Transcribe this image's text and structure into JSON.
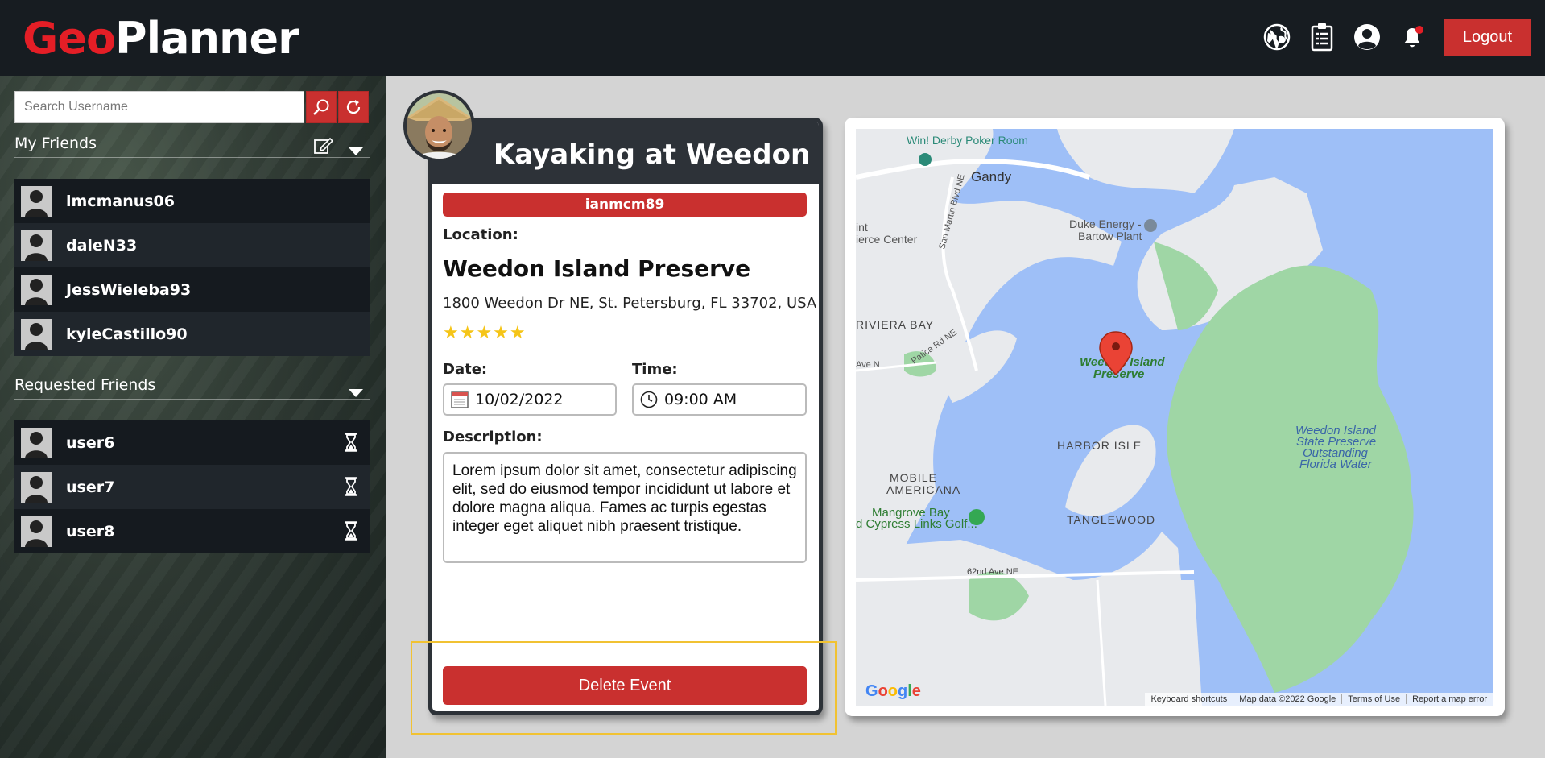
{
  "app": {
    "logo_part1": "Geo",
    "logo_part2": "Planner",
    "logout_label": "Logout",
    "header_icons": [
      "globe-icon",
      "clipboard-icon",
      "user-circle-icon",
      "bell-icon"
    ],
    "accent_color": "#c9302f",
    "logo_red": "#e41e26"
  },
  "sidebar": {
    "search_placeholder": "Search Username",
    "my_friends_title": "My Friends",
    "friends": [
      {
        "name": "lmcmanus06"
      },
      {
        "name": "daleN33"
      },
      {
        "name": "JessWieleba93"
      },
      {
        "name": "kyleCastillo90"
      }
    ],
    "requested_title": "Requested Friends",
    "requested": [
      {
        "name": "user6"
      },
      {
        "name": "user7"
      },
      {
        "name": "user8"
      }
    ]
  },
  "event": {
    "title": "Kayaking at Weedon",
    "owner": "ianmcm89",
    "location_label": "Location:",
    "place_name": "Weedon Island Preserve",
    "address": "1800 Weedon Dr NE, St. Petersburg, FL 33702, USA",
    "rating": "★★★★★",
    "date_label": "Date:",
    "date_value": "10/02/2022",
    "time_label": "Time:",
    "time_value": "09:00 AM",
    "description_label": "Description:",
    "description": "Lorem ipsum dolor sit amet, consectetur adipiscing elit, sed do eiusmod tempor incididunt ut labore et dolore magna aliqua. Fames ac turpis egestas integer eget aliquet nibh praesent tristique.",
    "delete_label": "Delete Event"
  },
  "map": {
    "labels": {
      "poker": "Win! Derby Poker Room",
      "gandy": "Gandy",
      "duke1": "Duke Energy -",
      "duke2": "Bartow Plant",
      "commerce1": "int",
      "commerce2": "ierce Center",
      "riviera": "RIVIERA BAY",
      "san_martin": "San Martin Blvd NE",
      "patica": "Patica Rd NE",
      "ave_n": "Ave N",
      "weedon1": "Weedon Island",
      "weedon2": "Preserve",
      "harbor": "HARBOR ISLE",
      "state1": "Weedon Island",
      "state2": "State Preserve",
      "state3": "Outstanding",
      "state4": "Florida Water",
      "mobile1": "MOBILE",
      "mobile2": "AMERICANA",
      "mangrove1": "Mangrove Bay",
      "mangrove2": "d Cypress Links Golf...",
      "tanglewood": "TANGLEWOOD",
      "ave62": "62nd Ave NE"
    },
    "footer": [
      "Keyboard shortcuts",
      "Map data ©2022 Google",
      "Terms of Use",
      "Report a map error"
    ],
    "water_color": "#9ebff7",
    "land_color": "#e8eaed",
    "park_color": "#9fd6a5"
  }
}
